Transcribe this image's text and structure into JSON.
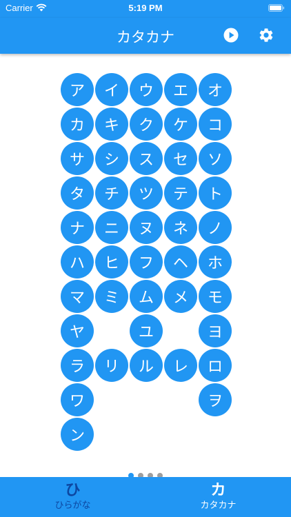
{
  "status_bar": {
    "carrier": "Carrier",
    "time": "5:19 PM"
  },
  "app_bar": {
    "title": "カタカナ",
    "play_icon": "play-circle-icon",
    "settings_icon": "gear-icon"
  },
  "kana_rows": [
    [
      "ア",
      "イ",
      "ウ",
      "エ",
      "オ"
    ],
    [
      "カ",
      "キ",
      "ク",
      "ケ",
      "コ"
    ],
    [
      "サ",
      "シ",
      "ス",
      "セ",
      "ソ"
    ],
    [
      "タ",
      "チ",
      "ツ",
      "テ",
      "ト"
    ],
    [
      "ナ",
      "ニ",
      "ヌ",
      "ネ",
      "ノ"
    ],
    [
      "ハ",
      "ヒ",
      "フ",
      "ヘ",
      "ホ"
    ],
    [
      "マ",
      "ミ",
      "ム",
      "メ",
      "モ"
    ],
    [
      "ヤ",
      "",
      "ユ",
      "",
      "ヨ"
    ],
    [
      "ラ",
      "リ",
      "ル",
      "レ",
      "ロ"
    ],
    [
      "ワ",
      "",
      "",
      "",
      "ヲ"
    ],
    [
      "ン",
      "",
      "",
      "",
      ""
    ]
  ],
  "page_indicator": {
    "count": 4,
    "active": 0
  },
  "tabs": [
    {
      "icon_text": "ひ",
      "label": "ひらがな",
      "selected": false
    },
    {
      "icon_text": "カ",
      "label": "カタカナ",
      "selected": true
    }
  ],
  "colors": {
    "accent": "#2196f3",
    "inactive_tab": "#0d47a1",
    "dot_inactive": "#9e9e9e"
  }
}
